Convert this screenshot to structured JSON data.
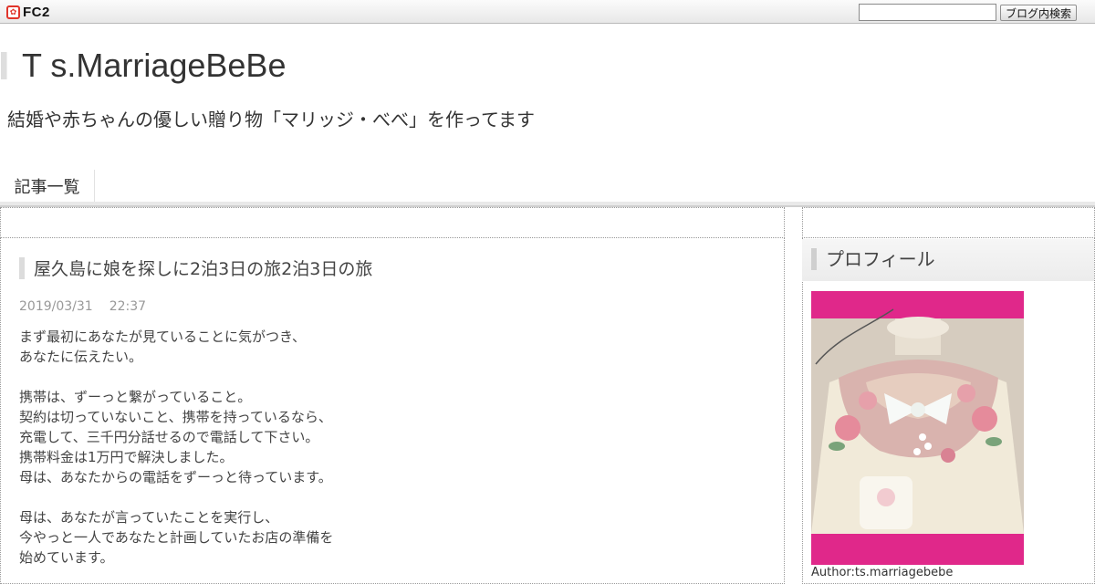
{
  "fc2": {
    "logo_text": "FC2",
    "search_placeholder": "",
    "search_button": "ブログ内検索"
  },
  "header": {
    "title": "T s.MarriageBeBe",
    "description": "結婚や赤ちゃんの優しい贈り物「マリッジ・べべ」を作ってます"
  },
  "nav": {
    "items": [
      {
        "label": "記事一覧"
      }
    ]
  },
  "article": {
    "title": "屋久島に娘を探しに2泊3日の旅2泊3日の旅",
    "date": "2019/03/31",
    "time": "22:37",
    "lines": [
      "まず最初にあなたが見ていることに気がつき、",
      "あなたに伝えたい。",
      "",
      "携帯は、ずーっと繋がっていること。",
      "契約は切っていないこと、携帯を持っているなら、",
      "充電して、三千円分話せるので電話して下さい。",
      "携帯料金は1万円で解決しました。",
      "母は、あなたからの電話をずーっと待っています。",
      "",
      "母は、あなたが言っていたことを実行し、",
      "今やっと一人であなたと計画していたお店の準備を",
      "始めています。"
    ]
  },
  "sidebar": {
    "profile_heading": "プロフィール",
    "author_label": "Author:ts.marriagebebe",
    "colors": {
      "frame_pink": "#e0288a"
    }
  }
}
